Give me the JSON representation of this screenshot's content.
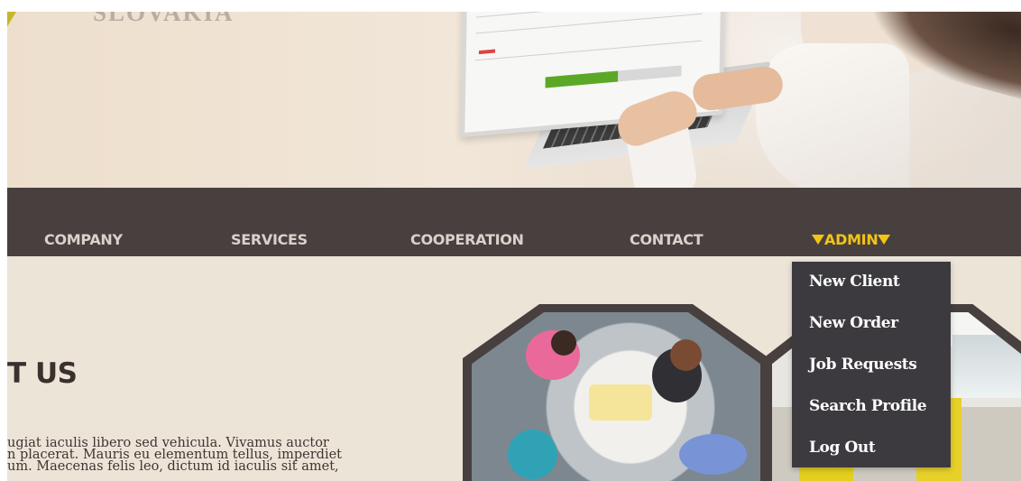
{
  "header": {
    "brand_text": "SLOVAKIA"
  },
  "nav": {
    "items": [
      {
        "label": "COMPANY"
      },
      {
        "label": "SERVICES"
      },
      {
        "label": "COOPERATION"
      },
      {
        "label": "CONTACT"
      }
    ],
    "admin": {
      "label": "ADMIN"
    }
  },
  "admin_menu": {
    "items": [
      {
        "label": "New Client"
      },
      {
        "label": "New Order"
      },
      {
        "label": "Job Requests"
      },
      {
        "label": "Search Profile"
      },
      {
        "label": "Log Out"
      }
    ]
  },
  "about": {
    "heading": "T US",
    "lines": [
      "ugiat iaculis libero sed vehicula. Vivamus auctor",
      "n placerat. Mauris eu elementum tellus, imperdiet",
      "um. Maecenas felis leo, dictum id iaculis sit amet,"
    ]
  },
  "colors": {
    "nav_background": "#48403f",
    "nav_text": "#d9d2cb",
    "admin_accent": "#f2c417",
    "dropdown_background": "#3c3a3f",
    "page_background": "#ede4d8"
  }
}
